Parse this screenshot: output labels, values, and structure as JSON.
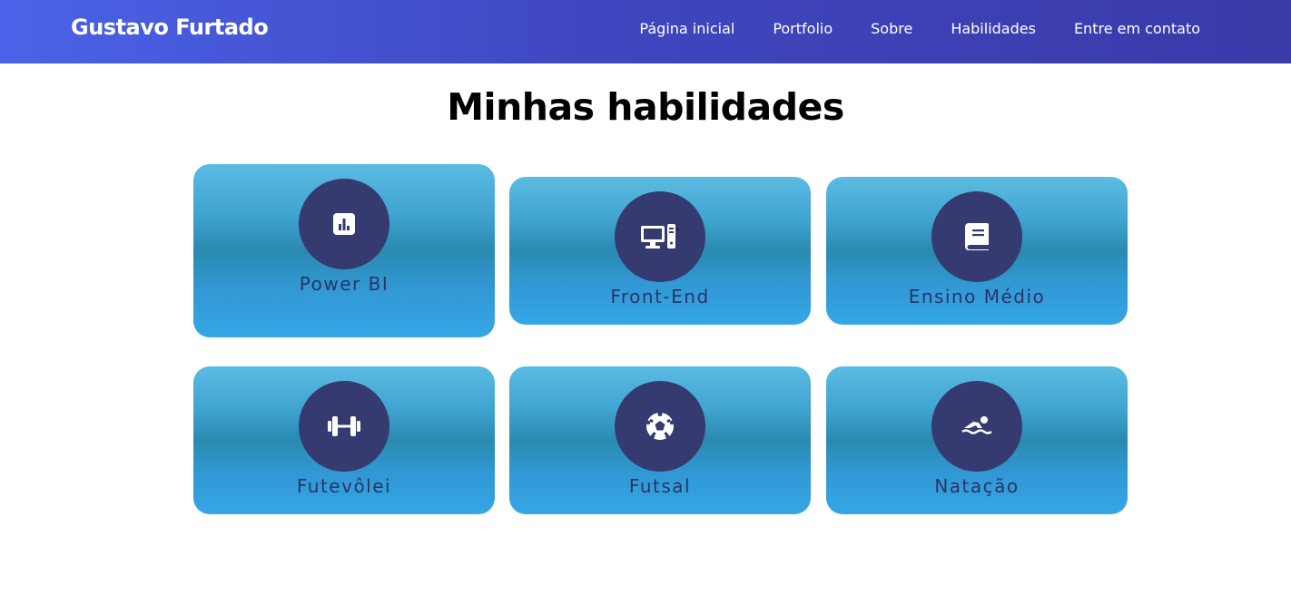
{
  "header": {
    "brand": "Gustavo Furtado",
    "nav": [
      {
        "label": "Página inicial"
      },
      {
        "label": "Portfolio"
      },
      {
        "label": "Sobre"
      },
      {
        "label": "Habilidades"
      },
      {
        "label": "Entre em contato"
      }
    ]
  },
  "main": {
    "title": "Minhas habilidades",
    "skills": [
      {
        "label": "Power BI",
        "icon": "chart-icon"
      },
      {
        "label": "Front-End",
        "icon": "computer-icon"
      },
      {
        "label": "Ensino Médio",
        "icon": "book-icon"
      },
      {
        "label": "Futevôlei",
        "icon": "dumbbell-icon"
      },
      {
        "label": "Futsal",
        "icon": "soccer-ball-icon"
      },
      {
        "label": "Natação",
        "icon": "swimmer-icon"
      }
    ]
  },
  "colors": {
    "header_start": "#4a63e8",
    "header_end": "#3a3aa8",
    "card_circle": "#353a70",
    "card_label": "#2b3468"
  }
}
